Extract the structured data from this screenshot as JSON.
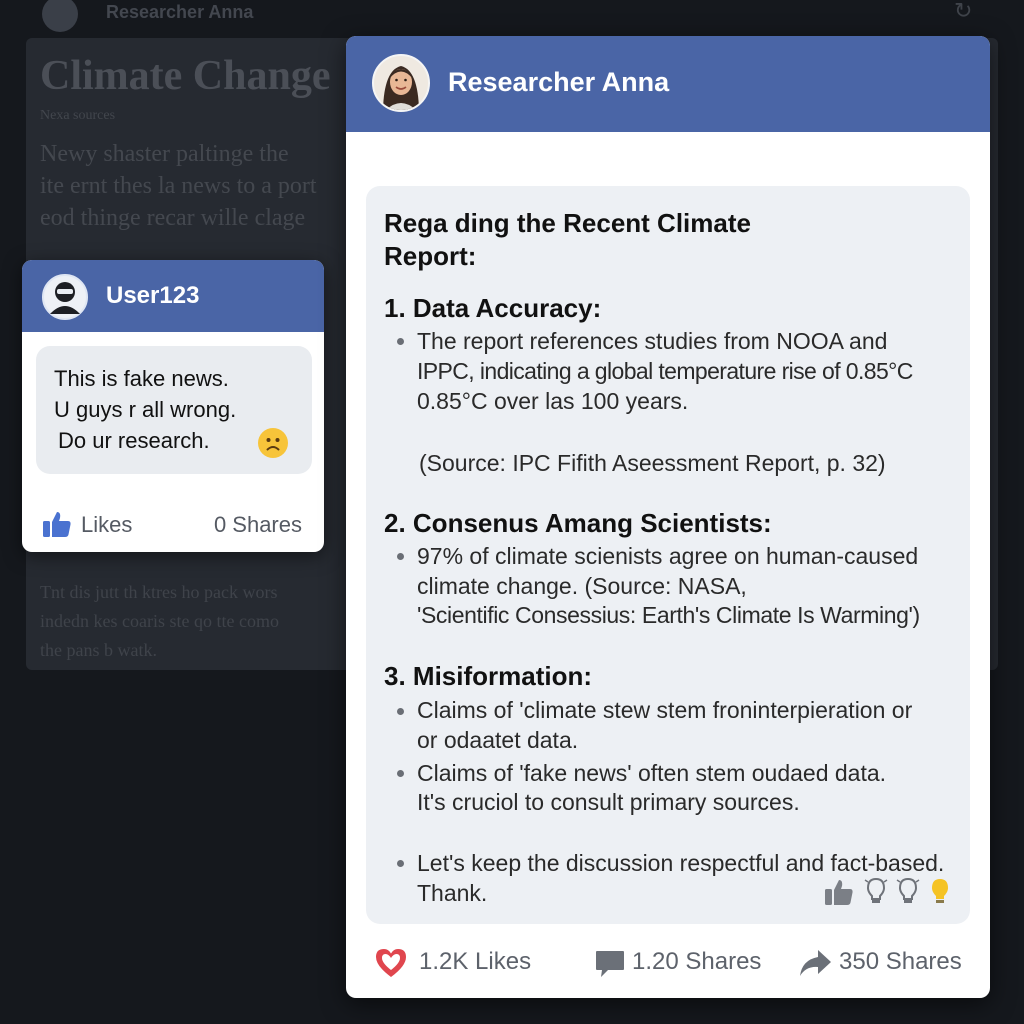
{
  "background": {
    "author": "Researcher Anna",
    "title": "Climate Change",
    "meta": "Nexa sources",
    "paragraph": [
      "Newy shaster paltinge the",
      "ite ernt thes la news to a port",
      "eod thinge recar wille clage"
    ],
    "paragraph2": [
      "Tnt dis jutt th ktres ho pack wors",
      "indedn kes coaris ste qo tte como",
      "the pans b watk."
    ]
  },
  "user_comment": {
    "username": "User123",
    "lines": [
      "This is fake news.",
      "U guys r all wrong.",
      "Do ur research."
    ],
    "likes_label": "Likes",
    "shares_label": "0 Shares"
  },
  "researcher_reply": {
    "username": "Researcher Anna",
    "title_lines": [
      "Rega ding the Recent Climate",
      "Report:"
    ],
    "sections": [
      {
        "heading": "1. Data Accuracy:",
        "lines": [
          "The report references studies from NOOA and",
          "IPPC, indicating a global temperature rise of 0.85°C",
          "0.85°C over las 100 years.",
          "(Source: IPC Fifith Aseessment Report, p. 32)"
        ]
      },
      {
        "heading": "2. Consenus Amang Scientists:",
        "lines": [
          "97% of climate scienists agree on human-caused",
          "climate change. (Source: NASA,",
          "'Scientific Consessius: Earth's Climate Is Warming')"
        ]
      },
      {
        "heading": "3. Misiformation:",
        "lines": [
          "Claims of 'climate stew stem froninterpieration or",
          "or odaatet data.",
          "Claims of 'fake news' often stem oudaed data.",
          "It's cruciol to consult primary sources.",
          "Let's keep the discussion respectful and fact-based.",
          "Thank."
        ]
      }
    ],
    "footer": {
      "likes": "1.2K Likes",
      "comments": "1.20 Shares",
      "shares": "350 Shares"
    }
  },
  "colors": {
    "header_blue": "#4a65a6",
    "like_red": "#e0464e",
    "thumb_blue": "#4a72d0",
    "bulb_yellow": "#f5c324"
  }
}
